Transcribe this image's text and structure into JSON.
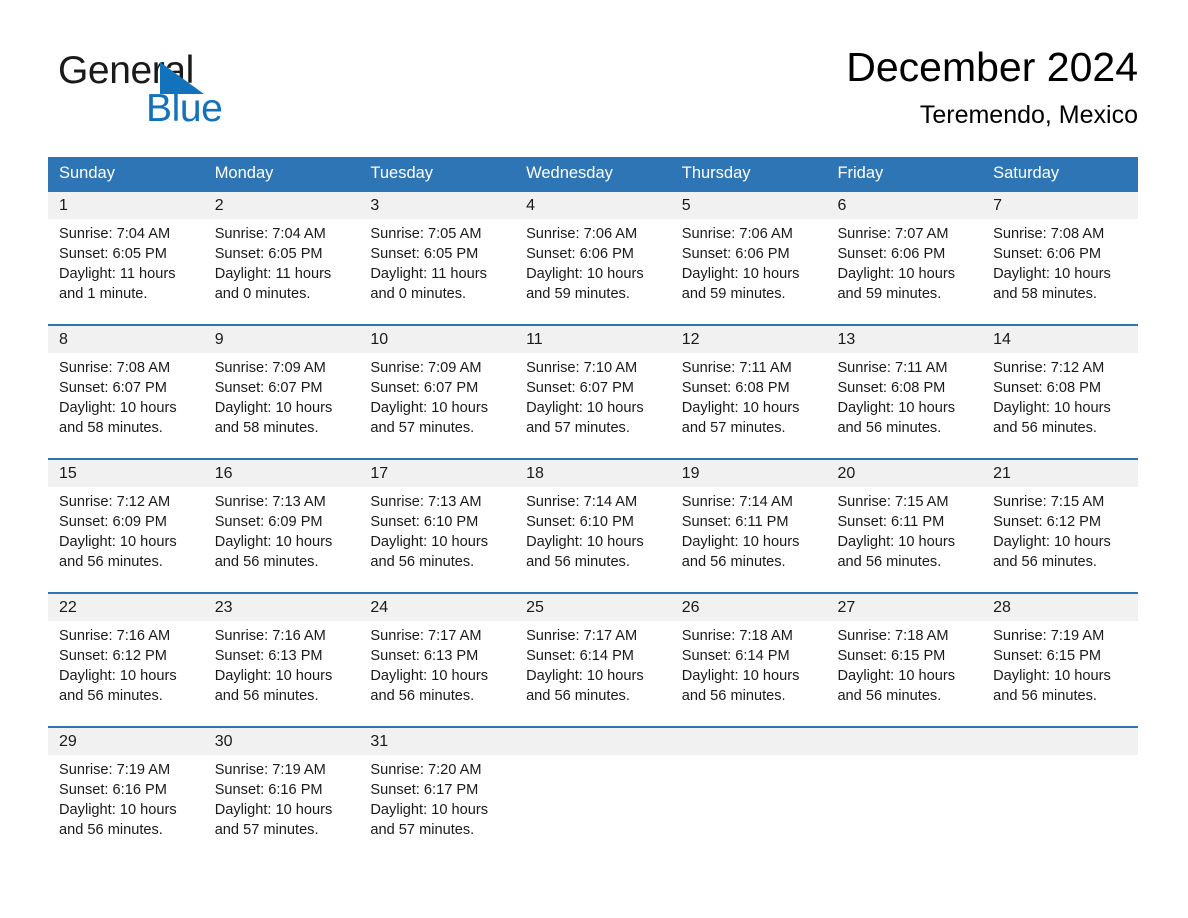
{
  "brand": {
    "name_part1": "General",
    "name_part2": "Blue",
    "triangle_color": "#1272bb",
    "icon": "triangle-logo-icon"
  },
  "header": {
    "title": "December 2024",
    "subtitle": "Teremendo, Mexico"
  },
  "theme": {
    "header_blue": "#2e75b6",
    "daynum_band": "#f1f1f1",
    "row_border": "#2e75b6",
    "text": "#1a1a1a"
  },
  "weekday_headers": [
    "Sunday",
    "Monday",
    "Tuesday",
    "Wednesday",
    "Thursday",
    "Friday",
    "Saturday"
  ],
  "weeks": [
    {
      "days": [
        {
          "num": "1",
          "sunrise": "Sunrise: 7:04 AM",
          "sunset": "Sunset: 6:05 PM",
          "daylight": "Daylight: 11 hours and 1 minute."
        },
        {
          "num": "2",
          "sunrise": "Sunrise: 7:04 AM",
          "sunset": "Sunset: 6:05 PM",
          "daylight": "Daylight: 11 hours and 0 minutes."
        },
        {
          "num": "3",
          "sunrise": "Sunrise: 7:05 AM",
          "sunset": "Sunset: 6:05 PM",
          "daylight": "Daylight: 11 hours and 0 minutes."
        },
        {
          "num": "4",
          "sunrise": "Sunrise: 7:06 AM",
          "sunset": "Sunset: 6:06 PM",
          "daylight": "Daylight: 10 hours and 59 minutes."
        },
        {
          "num": "5",
          "sunrise": "Sunrise: 7:06 AM",
          "sunset": "Sunset: 6:06 PM",
          "daylight": "Daylight: 10 hours and 59 minutes."
        },
        {
          "num": "6",
          "sunrise": "Sunrise: 7:07 AM",
          "sunset": "Sunset: 6:06 PM",
          "daylight": "Daylight: 10 hours and 59 minutes."
        },
        {
          "num": "7",
          "sunrise": "Sunrise: 7:08 AM",
          "sunset": "Sunset: 6:06 PM",
          "daylight": "Daylight: 10 hours and 58 minutes."
        }
      ]
    },
    {
      "days": [
        {
          "num": "8",
          "sunrise": "Sunrise: 7:08 AM",
          "sunset": "Sunset: 6:07 PM",
          "daylight": "Daylight: 10 hours and 58 minutes."
        },
        {
          "num": "9",
          "sunrise": "Sunrise: 7:09 AM",
          "sunset": "Sunset: 6:07 PM",
          "daylight": "Daylight: 10 hours and 58 minutes."
        },
        {
          "num": "10",
          "sunrise": "Sunrise: 7:09 AM",
          "sunset": "Sunset: 6:07 PM",
          "daylight": "Daylight: 10 hours and 57 minutes."
        },
        {
          "num": "11",
          "sunrise": "Sunrise: 7:10 AM",
          "sunset": "Sunset: 6:07 PM",
          "daylight": "Daylight: 10 hours and 57 minutes."
        },
        {
          "num": "12",
          "sunrise": "Sunrise: 7:11 AM",
          "sunset": "Sunset: 6:08 PM",
          "daylight": "Daylight: 10 hours and 57 minutes."
        },
        {
          "num": "13",
          "sunrise": "Sunrise: 7:11 AM",
          "sunset": "Sunset: 6:08 PM",
          "daylight": "Daylight: 10 hours and 56 minutes."
        },
        {
          "num": "14",
          "sunrise": "Sunrise: 7:12 AM",
          "sunset": "Sunset: 6:08 PM",
          "daylight": "Daylight: 10 hours and 56 minutes."
        }
      ]
    },
    {
      "days": [
        {
          "num": "15",
          "sunrise": "Sunrise: 7:12 AM",
          "sunset": "Sunset: 6:09 PM",
          "daylight": "Daylight: 10 hours and 56 minutes."
        },
        {
          "num": "16",
          "sunrise": "Sunrise: 7:13 AM",
          "sunset": "Sunset: 6:09 PM",
          "daylight": "Daylight: 10 hours and 56 minutes."
        },
        {
          "num": "17",
          "sunrise": "Sunrise: 7:13 AM",
          "sunset": "Sunset: 6:10 PM",
          "daylight": "Daylight: 10 hours and 56 minutes."
        },
        {
          "num": "18",
          "sunrise": "Sunrise: 7:14 AM",
          "sunset": "Sunset: 6:10 PM",
          "daylight": "Daylight: 10 hours and 56 minutes."
        },
        {
          "num": "19",
          "sunrise": "Sunrise: 7:14 AM",
          "sunset": "Sunset: 6:11 PM",
          "daylight": "Daylight: 10 hours and 56 minutes."
        },
        {
          "num": "20",
          "sunrise": "Sunrise: 7:15 AM",
          "sunset": "Sunset: 6:11 PM",
          "daylight": "Daylight: 10 hours and 56 minutes."
        },
        {
          "num": "21",
          "sunrise": "Sunrise: 7:15 AM",
          "sunset": "Sunset: 6:12 PM",
          "daylight": "Daylight: 10 hours and 56 minutes."
        }
      ]
    },
    {
      "days": [
        {
          "num": "22",
          "sunrise": "Sunrise: 7:16 AM",
          "sunset": "Sunset: 6:12 PM",
          "daylight": "Daylight: 10 hours and 56 minutes."
        },
        {
          "num": "23",
          "sunrise": "Sunrise: 7:16 AM",
          "sunset": "Sunset: 6:13 PM",
          "daylight": "Daylight: 10 hours and 56 minutes."
        },
        {
          "num": "24",
          "sunrise": "Sunrise: 7:17 AM",
          "sunset": "Sunset: 6:13 PM",
          "daylight": "Daylight: 10 hours and 56 minutes."
        },
        {
          "num": "25",
          "sunrise": "Sunrise: 7:17 AM",
          "sunset": "Sunset: 6:14 PM",
          "daylight": "Daylight: 10 hours and 56 minutes."
        },
        {
          "num": "26",
          "sunrise": "Sunrise: 7:18 AM",
          "sunset": "Sunset: 6:14 PM",
          "daylight": "Daylight: 10 hours and 56 minutes."
        },
        {
          "num": "27",
          "sunrise": "Sunrise: 7:18 AM",
          "sunset": "Sunset: 6:15 PM",
          "daylight": "Daylight: 10 hours and 56 minutes."
        },
        {
          "num": "28",
          "sunrise": "Sunrise: 7:19 AM",
          "sunset": "Sunset: 6:15 PM",
          "daylight": "Daylight: 10 hours and 56 minutes."
        }
      ]
    },
    {
      "days": [
        {
          "num": "29",
          "sunrise": "Sunrise: 7:19 AM",
          "sunset": "Sunset: 6:16 PM",
          "daylight": "Daylight: 10 hours and 56 minutes."
        },
        {
          "num": "30",
          "sunrise": "Sunrise: 7:19 AM",
          "sunset": "Sunset: 6:16 PM",
          "daylight": "Daylight: 10 hours and 57 minutes."
        },
        {
          "num": "31",
          "sunrise": "Sunrise: 7:20 AM",
          "sunset": "Sunset: 6:17 PM",
          "daylight": "Daylight: 10 hours and 57 minutes."
        },
        {
          "num": "",
          "sunrise": "",
          "sunset": "",
          "daylight": ""
        },
        {
          "num": "",
          "sunrise": "",
          "sunset": "",
          "daylight": ""
        },
        {
          "num": "",
          "sunrise": "",
          "sunset": "",
          "daylight": ""
        },
        {
          "num": "",
          "sunrise": "",
          "sunset": "",
          "daylight": ""
        }
      ]
    }
  ]
}
